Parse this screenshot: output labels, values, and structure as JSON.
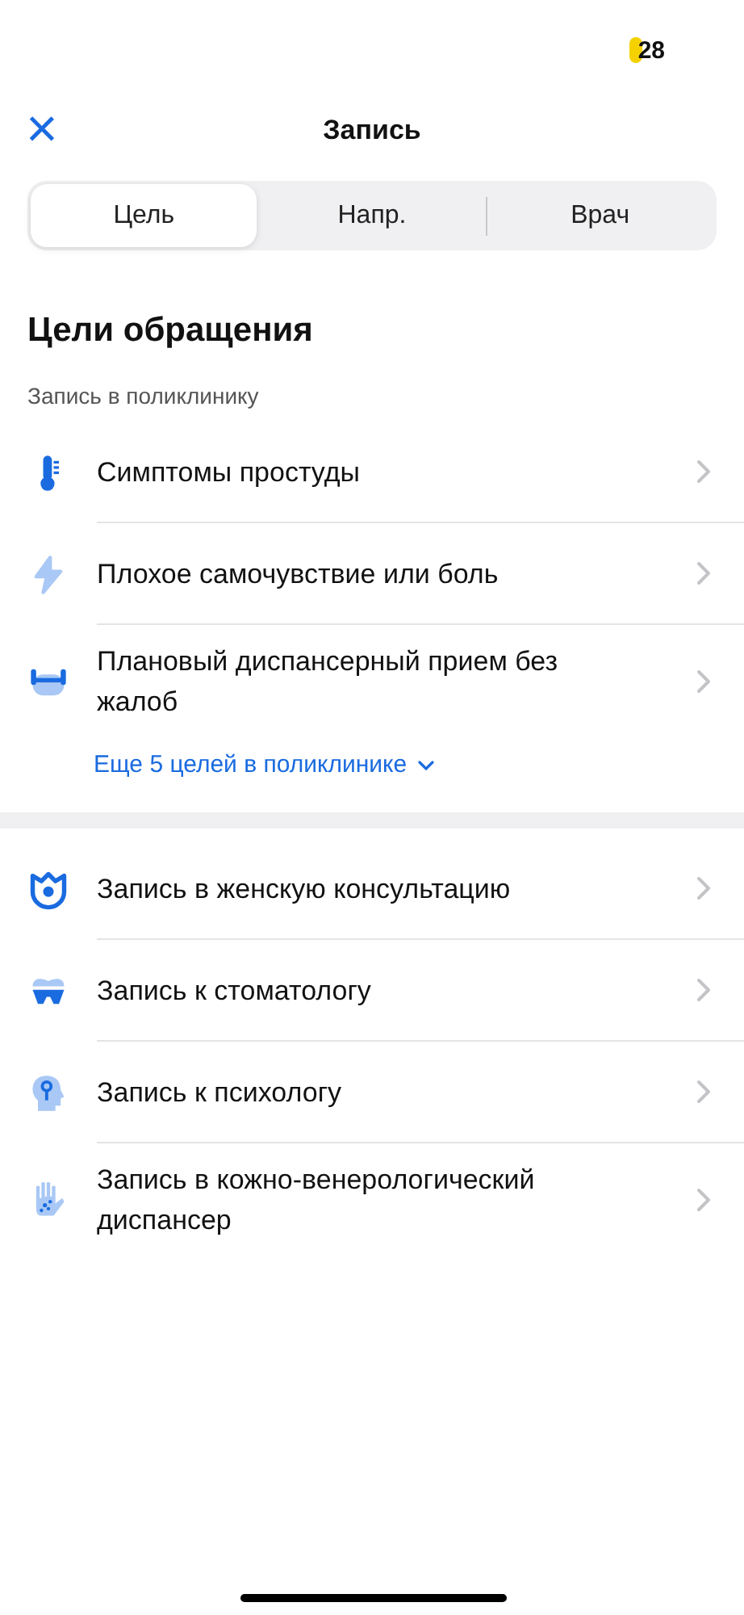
{
  "status_bar": {
    "badge": "28"
  },
  "nav": {
    "close": "×",
    "title": "Запись"
  },
  "tabs": [
    {
      "label": "Цель",
      "selected": true
    },
    {
      "label": "Напр.",
      "selected": false
    },
    {
      "label": "Врач",
      "selected": false
    }
  ],
  "heading": "Цели обращения",
  "sections": [
    {
      "subtitle": "Запись в поликлинику",
      "items": [
        {
          "label": "Симптомы простуды"
        },
        {
          "label": "Плохое самочувствие или боль"
        },
        {
          "label": "Плановый диспансерный прием без жалоб"
        }
      ],
      "more": "Еще 5 целей в поликлинике"
    },
    {
      "items": [
        {
          "label": "Запись в женскую консультацию"
        },
        {
          "label": "Запись к стоматологу"
        },
        {
          "label": "Запись к психологу"
        },
        {
          "label": "Запись в кожно-венерологический диспансер"
        }
      ]
    }
  ]
}
